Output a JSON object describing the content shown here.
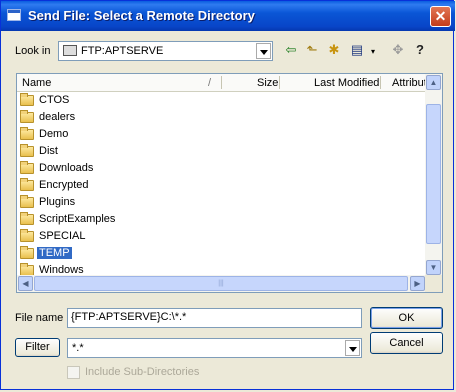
{
  "window": {
    "title": "Send File: Select a Remote Directory"
  },
  "toolbar": {
    "look_in_label": "Look in",
    "look_in_value": "FTP:APTSERVE"
  },
  "columns": [
    "Name",
    "Size",
    "Last Modified",
    "Attribut"
  ],
  "folders": [
    "CTOS",
    "dealers",
    "Demo",
    "Dist",
    "Downloads",
    "Encrypted",
    "Plugins",
    "ScriptExamples",
    "SPECIAL",
    "TEMP",
    "Windows"
  ],
  "selected_folder": "TEMP",
  "file_name": {
    "label": "File name",
    "value": "{FTP:APTSERVE}C:\\*.*"
  },
  "filter": {
    "button_label": "Filter",
    "value": "*.*"
  },
  "buttons": {
    "ok": "OK",
    "cancel": "Cancel"
  },
  "include_subdirs": {
    "label": "Include Sub-Directories",
    "checked": false,
    "enabled": false
  },
  "colors": {
    "titlebar": "#0a56d6",
    "selection": "#316ac5",
    "close": "#c43c1a"
  }
}
